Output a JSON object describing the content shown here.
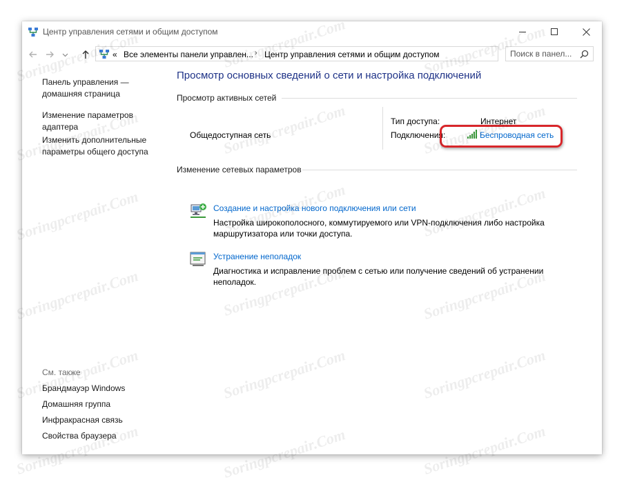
{
  "window": {
    "title": "Центр управления сетями и общим доступом"
  },
  "address": {
    "prefix": "«",
    "crumbs": [
      "Все элементы панели управлен...",
      "Центр управления сетями и общим доступом"
    ],
    "separator": "›"
  },
  "search": {
    "placeholder": "Поиск в панел..."
  },
  "left_pane": {
    "links": [
      "Панель управления — домашняя страница",
      "Изменение параметров адаптера",
      "Изменить дополнительные параметры общего доступа"
    ],
    "see_also_title": "См. также",
    "see_also": [
      "Брандмауэр Windows",
      "Домашняя группа",
      "Инфракрасная связь",
      "Свойства браузера"
    ]
  },
  "main": {
    "title": "Просмотр основных сведений о сети и настройка подключений",
    "active_networks_header": "Просмотр активных сетей",
    "network": {
      "name": "Общедоступная сеть",
      "access_type_label": "Тип доступа:",
      "access_type_value": "Интернет",
      "connections_label": "Подключения:",
      "connection_value": "Беспроводная сеть"
    },
    "change_settings_header": "Изменение сетевых параметров",
    "tasks": [
      {
        "title": "Создание и настройка нового подключения или сети",
        "description": "Настройка широкополосного, коммутируемого или VPN-подключения либо настройка маршрутизатора или точки доступа.",
        "icon": "new-connection-icon"
      },
      {
        "title": "Устранение неполадок",
        "description": "Диагностика и исправление проблем с сетью или получение сведений об устранении неполадок.",
        "icon": "troubleshoot-icon"
      }
    ]
  },
  "watermark": "Soringpcrepair.Com",
  "colors": {
    "link": "#0066cc",
    "title": "#1e3287",
    "highlight": "#d8262a"
  }
}
